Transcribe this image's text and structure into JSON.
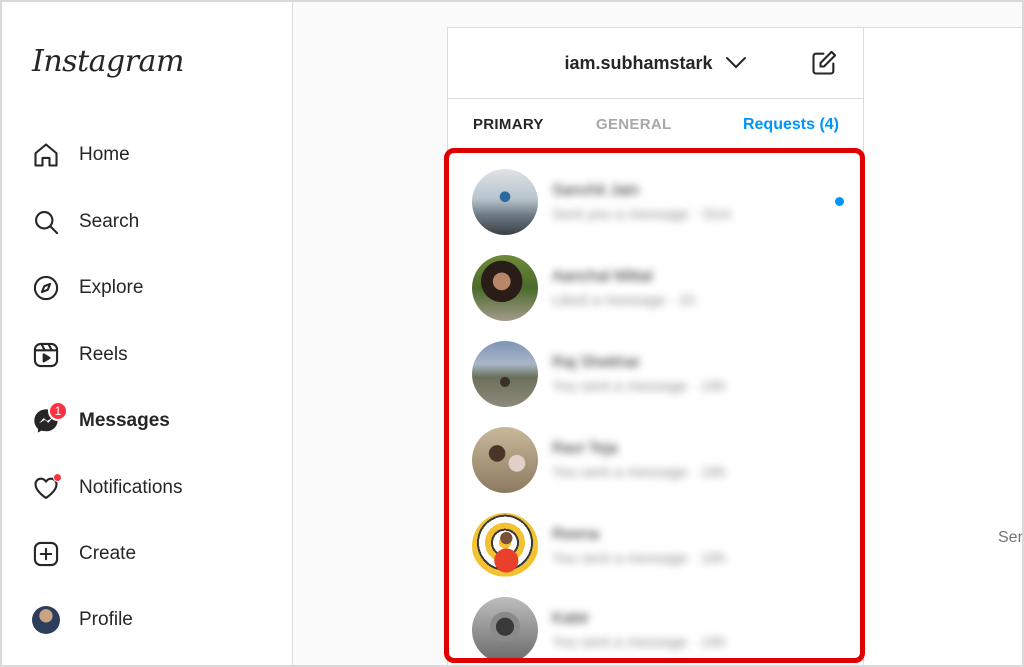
{
  "brand": {
    "logo_text": "Instagram"
  },
  "sidebar": {
    "items": [
      {
        "key": "home",
        "label": "Home",
        "icon": "home-icon"
      },
      {
        "key": "search",
        "label": "Search",
        "icon": "search-icon"
      },
      {
        "key": "explore",
        "label": "Explore",
        "icon": "compass-icon"
      },
      {
        "key": "reels",
        "label": "Reels",
        "icon": "reels-icon"
      },
      {
        "key": "messages",
        "label": "Messages",
        "icon": "messenger-icon",
        "badge": "1",
        "active": true
      },
      {
        "key": "notifications",
        "label": "Notifications",
        "icon": "heart-icon",
        "has_dot": true
      },
      {
        "key": "create",
        "label": "Create",
        "icon": "plus-square-icon"
      },
      {
        "key": "profile",
        "label": "Profile",
        "icon": "avatar"
      }
    ]
  },
  "inbox": {
    "username": "iam.subhamstark",
    "tabs": {
      "primary": "PRIMARY",
      "general": "GENERAL",
      "requests": "Requests (4)"
    },
    "threads": [
      {
        "name": "Sanchit Jain",
        "preview": "Sent you a message · 31m",
        "unread": true
      },
      {
        "name": "Aanchal Mittal",
        "preview": "Liked a message · 1h"
      },
      {
        "name": "Raj Shekhar",
        "preview": "You sent a message · 19h"
      },
      {
        "name": "Ravi Teja",
        "preview": "You sent a message · 19h"
      },
      {
        "name": "Reena",
        "preview": "You sent a message · 19h"
      },
      {
        "name": "Kabir",
        "preview": "You sent a message · 19h"
      }
    ]
  },
  "right_panel": {
    "partial_text": "Ser"
  },
  "colors": {
    "accent": "#0095f6",
    "badge": "#ff3040",
    "highlight": "#e00000"
  }
}
